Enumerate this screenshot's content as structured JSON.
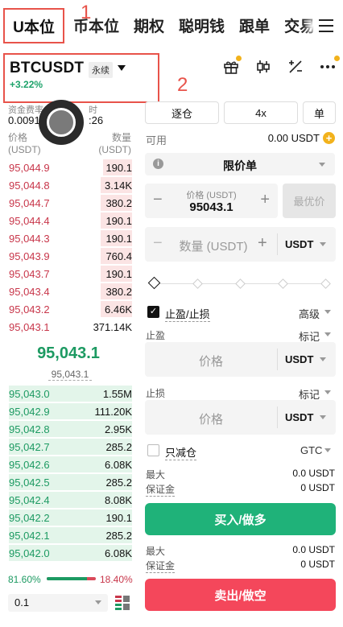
{
  "top_tabs": {
    "active": "U本位",
    "others": [
      "币本位",
      "期权",
      "聪明钱",
      "跟单",
      "交易"
    ],
    "annotation_1": "1",
    "annotation_2": "2"
  },
  "symbol": {
    "name": "BTCUSDT",
    "badge": "永续",
    "change": "+3.22%"
  },
  "funding": {
    "label": "资金费率",
    "value": "0.0091",
    "time_label": "时",
    "time_value": ":26"
  },
  "orderbook": {
    "price_header": "价格",
    "price_unit": "(USDT)",
    "qty_header": "数量",
    "qty_unit": "(USDT)",
    "asks": [
      {
        "price": "95,044.9",
        "qty": "190.1",
        "depth": 0.22
      },
      {
        "price": "95,044.8",
        "qty": "3.14K",
        "depth": 0.24
      },
      {
        "price": "95,044.7",
        "qty": "380.2",
        "depth": 0.24
      },
      {
        "price": "95,044.4",
        "qty": "190.1",
        "depth": 0.24
      },
      {
        "price": "95,044.3",
        "qty": "190.1",
        "depth": 0.24
      },
      {
        "price": "95,043.9",
        "qty": "760.4",
        "depth": 0.24
      },
      {
        "price": "95,043.7",
        "qty": "190.1",
        "depth": 0.24
      },
      {
        "price": "95,043.4",
        "qty": "380.2",
        "depth": 0.24
      },
      {
        "price": "95,043.2",
        "qty": "6.46K",
        "depth": 0.24
      },
      {
        "price": "95,043.1",
        "qty": "371.14K",
        "depth": 0.0
      }
    ],
    "mid_price": "95,043.1",
    "mark_price": "95,043.1",
    "bids": [
      {
        "price": "95,043.0",
        "qty": "1.55M",
        "depth": 0.93
      },
      {
        "price": "95,042.9",
        "qty": "111.20K",
        "depth": 0.93
      },
      {
        "price": "95,042.8",
        "qty": "2.95K",
        "depth": 0.93
      },
      {
        "price": "95,042.7",
        "qty": "285.2",
        "depth": 0.93
      },
      {
        "price": "95,042.6",
        "qty": "6.08K",
        "depth": 0.93
      },
      {
        "price": "95,042.5",
        "qty": "285.2",
        "depth": 0.93
      },
      {
        "price": "95,042.4",
        "qty": "8.08K",
        "depth": 0.93
      },
      {
        "price": "95,042.2",
        "qty": "190.1",
        "depth": 0.93
      },
      {
        "price": "95,042.1",
        "qty": "285.2",
        "depth": 0.93
      },
      {
        "price": "95,042.0",
        "qty": "6.08K",
        "depth": 0.93
      }
    ],
    "buy_ratio": "81.60%",
    "sell_ratio": "18.40%",
    "buy_ratio_value": 0.816,
    "precision": "0.1"
  },
  "order_form": {
    "margin_mode": "逐仓",
    "leverage": "4x",
    "position_mode": "单",
    "available_label": "可用",
    "available_value": "0.00 USDT",
    "order_type": "限价单",
    "price_label": "价格 (USDT)",
    "price_value": "95043.1",
    "best_price_label": "最优价",
    "qty_placeholder": "数量 (USDT)",
    "qty_unit": "USDT",
    "tpsl_label": "止盈/止损",
    "advanced_label": "高级",
    "tp_label": "止盈",
    "tp_trigger": "标记",
    "tp_price_placeholder": "价格",
    "tp_unit": "USDT",
    "sl_label": "止损",
    "sl_trigger": "标记",
    "sl_price_placeholder": "价格",
    "sl_unit": "USDT",
    "reduce_only_label": "只减仓",
    "tif": "GTC",
    "buy_max_label": "最大",
    "buy_max_value": "0.0 USDT",
    "buy_margin_label": "保证金",
    "buy_margin_value": "0 USDT",
    "buy_button": "买入/做多",
    "sell_max_label": "最大",
    "sell_max_value": "0.0 USDT",
    "sell_margin_label": "保证金",
    "sell_margin_value": "0 USDT",
    "sell_button": "卖出/做空"
  },
  "colors": {
    "ask": "#c8364a",
    "bid": "#1d9a62",
    "buy": "#1fb279",
    "sell": "#f4475b",
    "highlight": "#e8534a",
    "accent": "#f2b21c"
  },
  "icons": [
    "menu-icon",
    "gift-icon",
    "candlestick-icon",
    "calculator-icon",
    "more-icon",
    "info-icon",
    "layout-icon"
  ]
}
